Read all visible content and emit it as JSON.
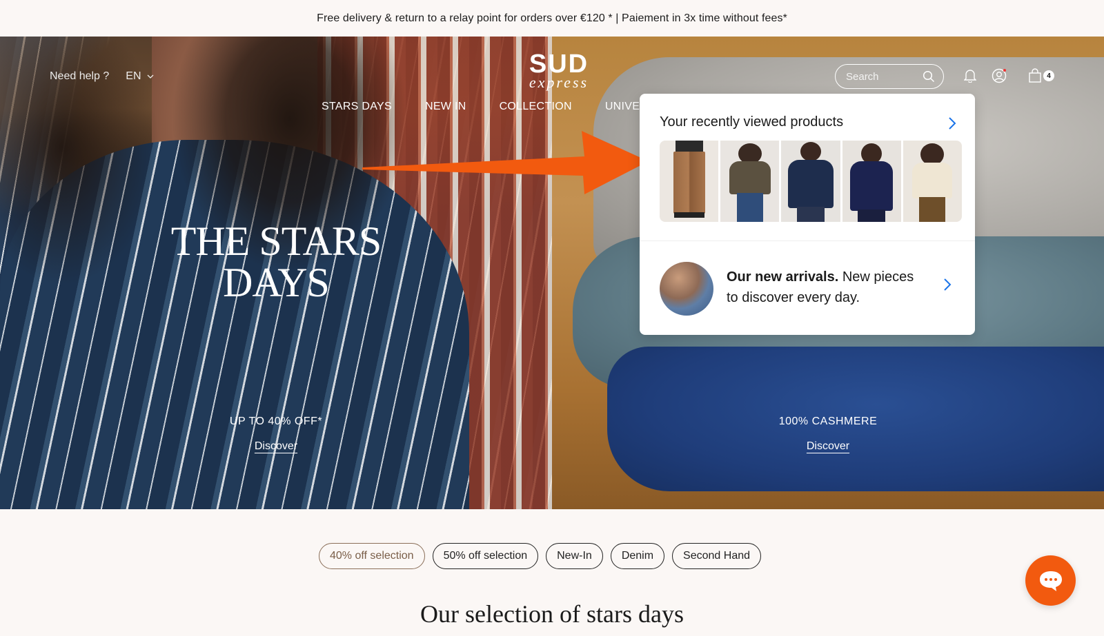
{
  "promo_bar": {
    "text": "Free delivery & return to a relay point for orders over €120 * | Paiement in 3x time without fees*"
  },
  "header": {
    "help": "Need help ?",
    "language": "EN",
    "logo_brand": "SUD",
    "logo_sub": "express",
    "nav": [
      "STARS DAYS",
      "NEW IN",
      "COLLECTION",
      "UNIVE"
    ],
    "search_placeholder": "Search",
    "cart_count": "4"
  },
  "hero": {
    "left": {
      "title_line1": "THE STARS",
      "title_line2": "DAYS",
      "subtitle": "UP TO 40% OFF*",
      "link": "Discover"
    },
    "right": {
      "subtitle": "100% CASHMERE",
      "link": "Discover"
    }
  },
  "popover": {
    "recent_title": "Your recently viewed products",
    "thumbnails": [
      "brown-wide-trousers",
      "olive-printed-blouse",
      "navy-ruffle-blouse",
      "navy-v-neck-top",
      "cream-cardigan"
    ],
    "arrivals_bold": "Our new arrivals.",
    "arrivals_text": " New pieces to discover every day."
  },
  "filters": {
    "chips": [
      "40% off selection",
      "50% off selection",
      "New-In",
      "Denim",
      "Second Hand"
    ],
    "active_index": 0
  },
  "section": {
    "title": "Our selection of stars days"
  },
  "colors": {
    "accent_orange": "#f25a0f",
    "active_chip": "#7a5e48",
    "link_blue": "#1a73e8"
  }
}
